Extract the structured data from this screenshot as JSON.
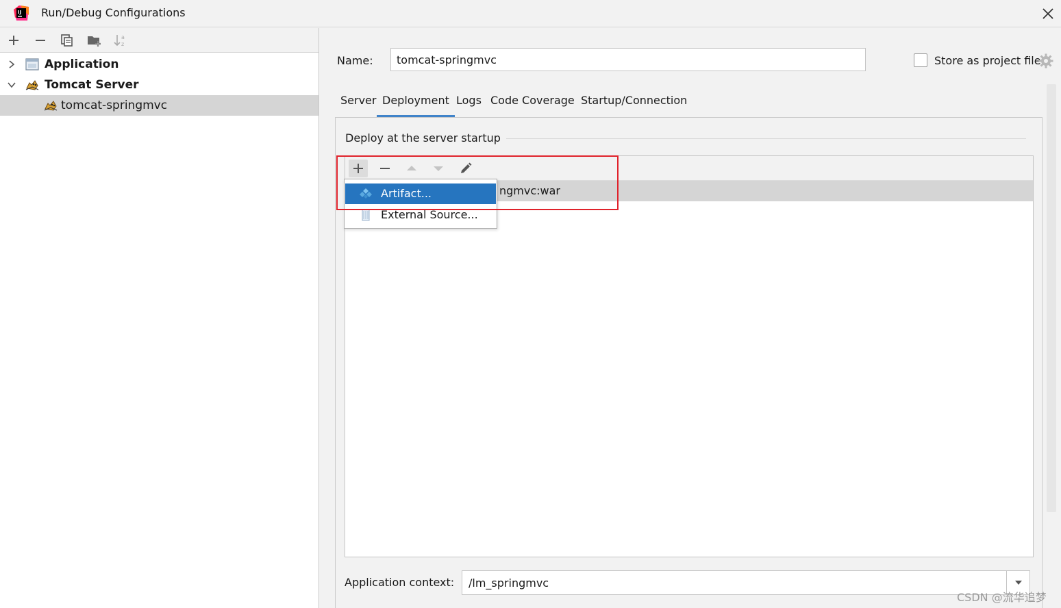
{
  "window": {
    "title": "Run/Debug Configurations",
    "app_icon": "intellij-idea-icon",
    "close_icon": "close-icon"
  },
  "left_toolbar": {
    "icons": [
      "add-icon",
      "remove-icon",
      "copy-icon",
      "new-folder-icon",
      "sort-alphabetically-icon"
    ]
  },
  "tree": {
    "items": [
      {
        "label": "Application",
        "icon": "application-icon",
        "expanded": false,
        "level": 0
      },
      {
        "label": "Tomcat Server",
        "icon": "tomcat-icon",
        "expanded": true,
        "level": 0
      },
      {
        "label": "tomcat-springmvc",
        "icon": "tomcat-icon",
        "selected": true,
        "level": 1
      }
    ]
  },
  "config": {
    "name_label": "Name:",
    "name_value": "tomcat-springmvc",
    "store_label": "Store as project file",
    "store_checked": false
  },
  "tabs": [
    {
      "label": "Server"
    },
    {
      "label": "Deployment",
      "active": true
    },
    {
      "label": "Logs"
    },
    {
      "label": "Code Coverage"
    },
    {
      "label": "Startup/Connection"
    }
  ],
  "deployment": {
    "section_title": "Deploy at the server startup",
    "toolbar_icons": [
      "add-icon",
      "remove-icon",
      "move-up-icon",
      "move-down-icon",
      "edit-icon"
    ],
    "row_text": "ngmvc:war",
    "popup": [
      {
        "label": "Artifact...",
        "icon": "artifact-icon",
        "highlighted": true
      },
      {
        "label": "External Source...",
        "icon": "external-source-icon"
      }
    ]
  },
  "context": {
    "label": "Application context:",
    "value": "/lm_springmvc"
  },
  "watermark": "CSDN @流华追梦",
  "colors": {
    "accent": "#4083c9",
    "highlight": "#2675bf",
    "annotation_red": "#e0222b",
    "selection": "#d5d5d5"
  }
}
